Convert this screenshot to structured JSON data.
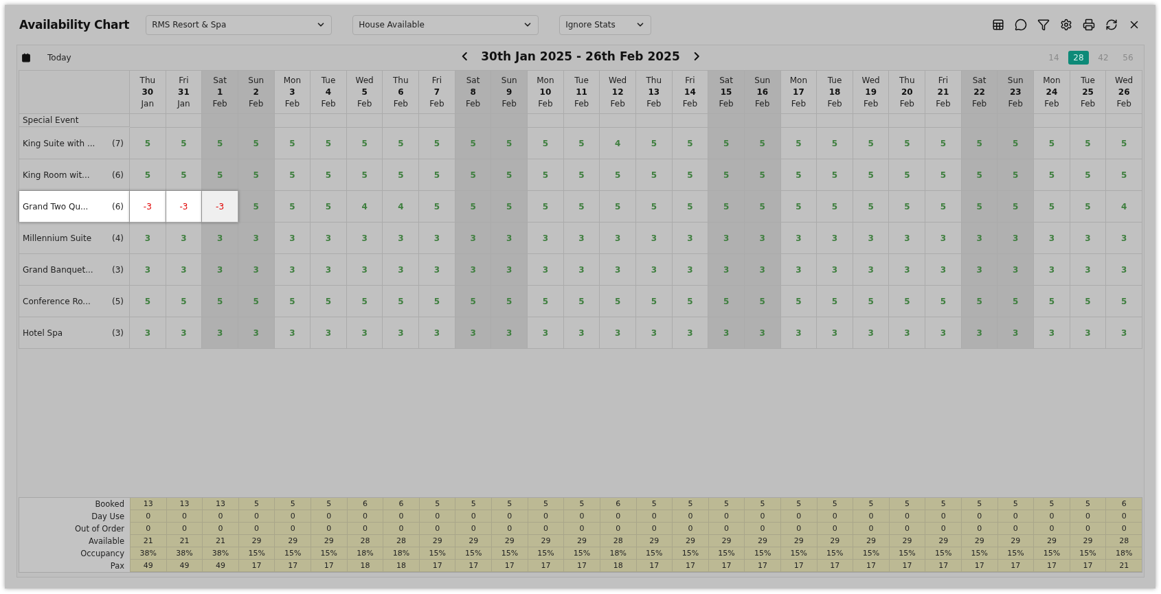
{
  "window": {
    "title": "Availability Chart"
  },
  "dropdowns": [
    {
      "value": "RMS Resort & Spa",
      "kind": "wide"
    },
    {
      "value": "House Available",
      "kind": "wide"
    },
    {
      "value": "Ignore Stats",
      "kind": "narrow"
    }
  ],
  "toolbar_icons": [
    {
      "kind": "sheet"
    },
    {
      "kind": "comment"
    },
    {
      "kind": "filter"
    },
    {
      "kind": "settings"
    },
    {
      "kind": "print"
    },
    {
      "kind": "refresh"
    },
    {
      "kind": "close"
    }
  ],
  "nav": {
    "today": "Today",
    "range": "30th Jan 2025 - 26th Feb 2025"
  },
  "periods": [
    {
      "label": "14",
      "selected": false
    },
    {
      "label": "28",
      "selected": true
    },
    {
      "label": "42",
      "selected": false
    },
    {
      "label": "56",
      "selected": false
    }
  ],
  "days": [
    {
      "dow": "Thu",
      "day": "30",
      "month": "Jan",
      "weekend": false
    },
    {
      "dow": "Fri",
      "day": "31",
      "month": "Jan",
      "weekend": false
    },
    {
      "dow": "Sat",
      "day": "1",
      "month": "Feb",
      "weekend": true
    },
    {
      "dow": "Sun",
      "day": "2",
      "month": "Feb",
      "weekend": true
    },
    {
      "dow": "Mon",
      "day": "3",
      "month": "Feb",
      "weekend": false
    },
    {
      "dow": "Tue",
      "day": "4",
      "month": "Feb",
      "weekend": false
    },
    {
      "dow": "Wed",
      "day": "5",
      "month": "Feb",
      "weekend": false
    },
    {
      "dow": "Thu",
      "day": "6",
      "month": "Feb",
      "weekend": false
    },
    {
      "dow": "Fri",
      "day": "7",
      "month": "Feb",
      "weekend": false
    },
    {
      "dow": "Sat",
      "day": "8",
      "month": "Feb",
      "weekend": true
    },
    {
      "dow": "Sun",
      "day": "9",
      "month": "Feb",
      "weekend": true
    },
    {
      "dow": "Mon",
      "day": "10",
      "month": "Feb",
      "weekend": false
    },
    {
      "dow": "Tue",
      "day": "11",
      "month": "Feb",
      "weekend": false
    },
    {
      "dow": "Wed",
      "day": "12",
      "month": "Feb",
      "weekend": false
    },
    {
      "dow": "Thu",
      "day": "13",
      "month": "Feb",
      "weekend": false
    },
    {
      "dow": "Fri",
      "day": "14",
      "month": "Feb",
      "weekend": false
    },
    {
      "dow": "Sat",
      "day": "15",
      "month": "Feb",
      "weekend": true
    },
    {
      "dow": "Sun",
      "day": "16",
      "month": "Feb",
      "weekend": true
    },
    {
      "dow": "Mon",
      "day": "17",
      "month": "Feb",
      "weekend": false
    },
    {
      "dow": "Tue",
      "day": "18",
      "month": "Feb",
      "weekend": false
    },
    {
      "dow": "Wed",
      "day": "19",
      "month": "Feb",
      "weekend": false
    },
    {
      "dow": "Thu",
      "day": "20",
      "month": "Feb",
      "weekend": false
    },
    {
      "dow": "Fri",
      "day": "21",
      "month": "Feb",
      "weekend": false
    },
    {
      "dow": "Sat",
      "day": "22",
      "month": "Feb",
      "weekend": true
    },
    {
      "dow": "Sun",
      "day": "23",
      "month": "Feb",
      "weekend": true
    },
    {
      "dow": "Mon",
      "day": "24",
      "month": "Feb",
      "weekend": false
    },
    {
      "dow": "Tue",
      "day": "25",
      "month": "Feb",
      "weekend": false
    },
    {
      "dow": "Wed",
      "day": "26",
      "month": "Feb",
      "weekend": false
    }
  ],
  "special_event_label": "Special Event",
  "rows": [
    {
      "name": "King Suite with ...",
      "count": "(7)",
      "highlighted": false,
      "cells": [
        {
          "value": "5",
          "overbooked": false
        },
        {
          "value": "5",
          "overbooked": false
        },
        {
          "value": "5",
          "overbooked": false
        },
        {
          "value": "5",
          "overbooked": false
        },
        {
          "value": "5",
          "overbooked": false
        },
        {
          "value": "5",
          "overbooked": false
        },
        {
          "value": "5",
          "overbooked": false
        },
        {
          "value": "5",
          "overbooked": false
        },
        {
          "value": "5",
          "overbooked": false
        },
        {
          "value": "5",
          "overbooked": false
        },
        {
          "value": "5",
          "overbooked": false
        },
        {
          "value": "5",
          "overbooked": false
        },
        {
          "value": "5",
          "overbooked": false
        },
        {
          "value": "4",
          "overbooked": false
        },
        {
          "value": "5",
          "overbooked": false
        },
        {
          "value": "5",
          "overbooked": false
        },
        {
          "value": "5",
          "overbooked": false
        },
        {
          "value": "5",
          "overbooked": false
        },
        {
          "value": "5",
          "overbooked": false
        },
        {
          "value": "5",
          "overbooked": false
        },
        {
          "value": "5",
          "overbooked": false
        },
        {
          "value": "5",
          "overbooked": false
        },
        {
          "value": "5",
          "overbooked": false
        },
        {
          "value": "5",
          "overbooked": false
        },
        {
          "value": "5",
          "overbooked": false
        },
        {
          "value": "5",
          "overbooked": false
        },
        {
          "value": "5",
          "overbooked": false
        },
        {
          "value": "5",
          "overbooked": false
        }
      ]
    },
    {
      "name": "King Room wit...",
      "count": "(6)",
      "highlighted": false,
      "cells": [
        {
          "value": "5",
          "overbooked": false
        },
        {
          "value": "5",
          "overbooked": false
        },
        {
          "value": "5",
          "overbooked": false
        },
        {
          "value": "5",
          "overbooked": false
        },
        {
          "value": "5",
          "overbooked": false
        },
        {
          "value": "5",
          "overbooked": false
        },
        {
          "value": "5",
          "overbooked": false
        },
        {
          "value": "5",
          "overbooked": false
        },
        {
          "value": "5",
          "overbooked": false
        },
        {
          "value": "5",
          "overbooked": false
        },
        {
          "value": "5",
          "overbooked": false
        },
        {
          "value": "5",
          "overbooked": false
        },
        {
          "value": "5",
          "overbooked": false
        },
        {
          "value": "5",
          "overbooked": false
        },
        {
          "value": "5",
          "overbooked": false
        },
        {
          "value": "5",
          "overbooked": false
        },
        {
          "value": "5",
          "overbooked": false
        },
        {
          "value": "5",
          "overbooked": false
        },
        {
          "value": "5",
          "overbooked": false
        },
        {
          "value": "5",
          "overbooked": false
        },
        {
          "value": "5",
          "overbooked": false
        },
        {
          "value": "5",
          "overbooked": false
        },
        {
          "value": "5",
          "overbooked": false
        },
        {
          "value": "5",
          "overbooked": false
        },
        {
          "value": "5",
          "overbooked": false
        },
        {
          "value": "5",
          "overbooked": false
        },
        {
          "value": "5",
          "overbooked": false
        },
        {
          "value": "5",
          "overbooked": false
        }
      ]
    },
    {
      "name": "Grand Two Qu...",
      "count": "(6)",
      "highlighted": true,
      "cells": [
        {
          "value": "-3",
          "overbooked": true
        },
        {
          "value": "-3",
          "overbooked": true
        },
        {
          "value": "-3",
          "overbooked": true
        },
        {
          "value": "5",
          "overbooked": false
        },
        {
          "value": "5",
          "overbooked": false
        },
        {
          "value": "5",
          "overbooked": false
        },
        {
          "value": "4",
          "overbooked": false
        },
        {
          "value": "4",
          "overbooked": false
        },
        {
          "value": "5",
          "overbooked": false
        },
        {
          "value": "5",
          "overbooked": false
        },
        {
          "value": "5",
          "overbooked": false
        },
        {
          "value": "5",
          "overbooked": false
        },
        {
          "value": "5",
          "overbooked": false
        },
        {
          "value": "5",
          "overbooked": false
        },
        {
          "value": "5",
          "overbooked": false
        },
        {
          "value": "5",
          "overbooked": false
        },
        {
          "value": "5",
          "overbooked": false
        },
        {
          "value": "5",
          "overbooked": false
        },
        {
          "value": "5",
          "overbooked": false
        },
        {
          "value": "5",
          "overbooked": false
        },
        {
          "value": "5",
          "overbooked": false
        },
        {
          "value": "5",
          "overbooked": false
        },
        {
          "value": "5",
          "overbooked": false
        },
        {
          "value": "5",
          "overbooked": false
        },
        {
          "value": "5",
          "overbooked": false
        },
        {
          "value": "5",
          "overbooked": false
        },
        {
          "value": "5",
          "overbooked": false
        },
        {
          "value": "4",
          "overbooked": false
        }
      ]
    },
    {
      "name": "Millennium Suite",
      "count": "(4)",
      "highlighted": false,
      "cells": [
        {
          "value": "3",
          "overbooked": false
        },
        {
          "value": "3",
          "overbooked": false
        },
        {
          "value": "3",
          "overbooked": false
        },
        {
          "value": "3",
          "overbooked": false
        },
        {
          "value": "3",
          "overbooked": false
        },
        {
          "value": "3",
          "overbooked": false
        },
        {
          "value": "3",
          "overbooked": false
        },
        {
          "value": "3",
          "overbooked": false
        },
        {
          "value": "3",
          "overbooked": false
        },
        {
          "value": "3",
          "overbooked": false
        },
        {
          "value": "3",
          "overbooked": false
        },
        {
          "value": "3",
          "overbooked": false
        },
        {
          "value": "3",
          "overbooked": false
        },
        {
          "value": "3",
          "overbooked": false
        },
        {
          "value": "3",
          "overbooked": false
        },
        {
          "value": "3",
          "overbooked": false
        },
        {
          "value": "3",
          "overbooked": false
        },
        {
          "value": "3",
          "overbooked": false
        },
        {
          "value": "3",
          "overbooked": false
        },
        {
          "value": "3",
          "overbooked": false
        },
        {
          "value": "3",
          "overbooked": false
        },
        {
          "value": "3",
          "overbooked": false
        },
        {
          "value": "3",
          "overbooked": false
        },
        {
          "value": "3",
          "overbooked": false
        },
        {
          "value": "3",
          "overbooked": false
        },
        {
          "value": "3",
          "overbooked": false
        },
        {
          "value": "3",
          "overbooked": false
        },
        {
          "value": "3",
          "overbooked": false
        }
      ]
    },
    {
      "name": "Grand Banquet...",
      "count": "(3)",
      "highlighted": false,
      "cells": [
        {
          "value": "3",
          "overbooked": false
        },
        {
          "value": "3",
          "overbooked": false
        },
        {
          "value": "3",
          "overbooked": false
        },
        {
          "value": "3",
          "overbooked": false
        },
        {
          "value": "3",
          "overbooked": false
        },
        {
          "value": "3",
          "overbooked": false
        },
        {
          "value": "3",
          "overbooked": false
        },
        {
          "value": "3",
          "overbooked": false
        },
        {
          "value": "3",
          "overbooked": false
        },
        {
          "value": "3",
          "overbooked": false
        },
        {
          "value": "3",
          "overbooked": false
        },
        {
          "value": "3",
          "overbooked": false
        },
        {
          "value": "3",
          "overbooked": false
        },
        {
          "value": "3",
          "overbooked": false
        },
        {
          "value": "3",
          "overbooked": false
        },
        {
          "value": "3",
          "overbooked": false
        },
        {
          "value": "3",
          "overbooked": false
        },
        {
          "value": "3",
          "overbooked": false
        },
        {
          "value": "3",
          "overbooked": false
        },
        {
          "value": "3",
          "overbooked": false
        },
        {
          "value": "3",
          "overbooked": false
        },
        {
          "value": "3",
          "overbooked": false
        },
        {
          "value": "3",
          "overbooked": false
        },
        {
          "value": "3",
          "overbooked": false
        },
        {
          "value": "3",
          "overbooked": false
        },
        {
          "value": "3",
          "overbooked": false
        },
        {
          "value": "3",
          "overbooked": false
        },
        {
          "value": "3",
          "overbooked": false
        }
      ]
    },
    {
      "name": "Conference Ro...",
      "count": "(5)",
      "highlighted": false,
      "cells": [
        {
          "value": "5",
          "overbooked": false
        },
        {
          "value": "5",
          "overbooked": false
        },
        {
          "value": "5",
          "overbooked": false
        },
        {
          "value": "5",
          "overbooked": false
        },
        {
          "value": "5",
          "overbooked": false
        },
        {
          "value": "5",
          "overbooked": false
        },
        {
          "value": "5",
          "overbooked": false
        },
        {
          "value": "5",
          "overbooked": false
        },
        {
          "value": "5",
          "overbooked": false
        },
        {
          "value": "5",
          "overbooked": false
        },
        {
          "value": "5",
          "overbooked": false
        },
        {
          "value": "5",
          "overbooked": false
        },
        {
          "value": "5",
          "overbooked": false
        },
        {
          "value": "5",
          "overbooked": false
        },
        {
          "value": "5",
          "overbooked": false
        },
        {
          "value": "5",
          "overbooked": false
        },
        {
          "value": "5",
          "overbooked": false
        },
        {
          "value": "5",
          "overbooked": false
        },
        {
          "value": "5",
          "overbooked": false
        },
        {
          "value": "5",
          "overbooked": false
        },
        {
          "value": "5",
          "overbooked": false
        },
        {
          "value": "5",
          "overbooked": false
        },
        {
          "value": "5",
          "overbooked": false
        },
        {
          "value": "5",
          "overbooked": false
        },
        {
          "value": "5",
          "overbooked": false
        },
        {
          "value": "5",
          "overbooked": false
        },
        {
          "value": "5",
          "overbooked": false
        },
        {
          "value": "5",
          "overbooked": false
        }
      ]
    },
    {
      "name": "Hotel Spa",
      "count": "(3)",
      "highlighted": false,
      "cells": [
        {
          "value": "3",
          "overbooked": false
        },
        {
          "value": "3",
          "overbooked": false
        },
        {
          "value": "3",
          "overbooked": false
        },
        {
          "value": "3",
          "overbooked": false
        },
        {
          "value": "3",
          "overbooked": false
        },
        {
          "value": "3",
          "overbooked": false
        },
        {
          "value": "3",
          "overbooked": false
        },
        {
          "value": "3",
          "overbooked": false
        },
        {
          "value": "3",
          "overbooked": false
        },
        {
          "value": "3",
          "overbooked": false
        },
        {
          "value": "3",
          "overbooked": false
        },
        {
          "value": "3",
          "overbooked": false
        },
        {
          "value": "3",
          "overbooked": false
        },
        {
          "value": "3",
          "overbooked": false
        },
        {
          "value": "3",
          "overbooked": false
        },
        {
          "value": "3",
          "overbooked": false
        },
        {
          "value": "3",
          "overbooked": false
        },
        {
          "value": "3",
          "overbooked": false
        },
        {
          "value": "3",
          "overbooked": false
        },
        {
          "value": "3",
          "overbooked": false
        },
        {
          "value": "3",
          "overbooked": false
        },
        {
          "value": "3",
          "overbooked": false
        },
        {
          "value": "3",
          "overbooked": false
        },
        {
          "value": "3",
          "overbooked": false
        },
        {
          "value": "3",
          "overbooked": false
        },
        {
          "value": "3",
          "overbooked": false
        },
        {
          "value": "3",
          "overbooked": false
        },
        {
          "value": "3",
          "overbooked": false
        }
      ]
    }
  ],
  "summary": [
    {
      "label": "Booked",
      "values": [
        "13",
        "13",
        "13",
        "5",
        "5",
        "5",
        "6",
        "6",
        "5",
        "5",
        "5",
        "5",
        "5",
        "6",
        "5",
        "5",
        "5",
        "5",
        "5",
        "5",
        "5",
        "5",
        "5",
        "5",
        "5",
        "5",
        "5",
        "6"
      ]
    },
    {
      "label": "Day Use",
      "values": [
        "0",
        "0",
        "0",
        "0",
        "0",
        "0",
        "0",
        "0",
        "0",
        "0",
        "0",
        "0",
        "0",
        "0",
        "0",
        "0",
        "0",
        "0",
        "0",
        "0",
        "0",
        "0",
        "0",
        "0",
        "0",
        "0",
        "0",
        "0"
      ]
    },
    {
      "label": "Out of Order",
      "values": [
        "0",
        "0",
        "0",
        "0",
        "0",
        "0",
        "0",
        "0",
        "0",
        "0",
        "0",
        "0",
        "0",
        "0",
        "0",
        "0",
        "0",
        "0",
        "0",
        "0",
        "0",
        "0",
        "0",
        "0",
        "0",
        "0",
        "0",
        "0"
      ]
    },
    {
      "label": "Available",
      "values": [
        "21",
        "21",
        "21",
        "29",
        "29",
        "29",
        "28",
        "28",
        "29",
        "29",
        "29",
        "29",
        "29",
        "28",
        "29",
        "29",
        "29",
        "29",
        "29",
        "29",
        "29",
        "29",
        "29",
        "29",
        "29",
        "29",
        "29",
        "28"
      ]
    },
    {
      "label": "Occupancy",
      "values": [
        "38%",
        "38%",
        "38%",
        "15%",
        "15%",
        "15%",
        "18%",
        "18%",
        "15%",
        "15%",
        "15%",
        "15%",
        "15%",
        "18%",
        "15%",
        "15%",
        "15%",
        "15%",
        "15%",
        "15%",
        "15%",
        "15%",
        "15%",
        "15%",
        "15%",
        "15%",
        "15%",
        "18%"
      ]
    },
    {
      "label": "Pax",
      "values": [
        "49",
        "49",
        "49",
        "17",
        "17",
        "17",
        "18",
        "18",
        "17",
        "17",
        "17",
        "17",
        "17",
        "18",
        "17",
        "17",
        "17",
        "17",
        "17",
        "17",
        "17",
        "17",
        "17",
        "17",
        "17",
        "17",
        "17",
        "21"
      ]
    }
  ]
}
